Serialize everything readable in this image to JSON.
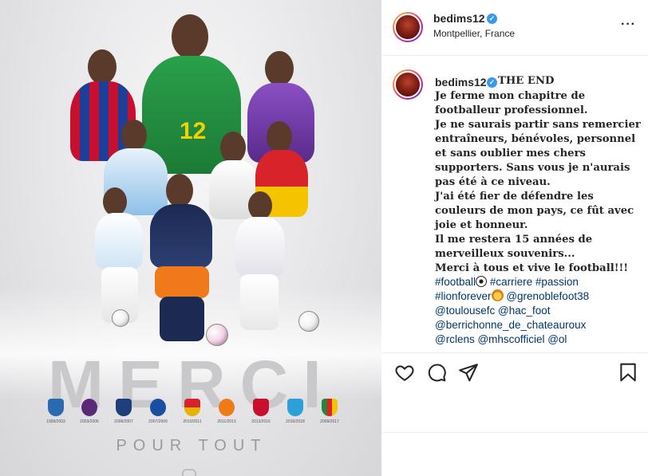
{
  "post": {
    "username": "bedims12",
    "location": "Montpellier, France",
    "caption_title": "THE END",
    "caption_lines": [
      "Je ferme mon chapitre de",
      "footballeur professionnel.",
      "Je ne saurais partir sans remercier",
      "entraîneurs, bénévoles, personnel",
      "et sans oublier mes chers",
      "supporters. Sans vous je n'aurais",
      "pas été à ce niveau.",
      "J'ai été fier de défendre les",
      "couleurs de mon pays, ce fût avec",
      "joie et honneur.",
      "Il me restera 15 années de",
      "merveilleux souvenirs...",
      "Merci à tous et vive le football!!!"
    ],
    "tags": {
      "line1_a": "#football",
      "line1_b": "#carriere #passion",
      "line2_a": "#lionforever",
      "line2_b": "@grenoblefoot38",
      "line3": "@toulousefc @hac_foot",
      "line4": "@berrichonne_de_chateauroux",
      "line5": "@rclens @mhscofficiel @ol"
    }
  },
  "poster": {
    "headline": "MERCI",
    "subline": "POUR TOUT",
    "shirt_number": "12",
    "clubs": [
      {
        "years": "1999/2003",
        "color": "#2a6ab0"
      },
      {
        "years": "2003/2006",
        "color": "#5a2a7a"
      },
      {
        "years": "2006/2007",
        "color": "#1d3f7a"
      },
      {
        "years": "2007/2009",
        "color": "#1b4ea0"
      },
      {
        "years": "2010/2011",
        "color": "#e6b400"
      },
      {
        "years": "2011/2013",
        "color": "#f07a1a"
      },
      {
        "years": "2013/2016",
        "color": "#c8102e"
      },
      {
        "years": "2016/2018",
        "color": "#2d9fd9"
      },
      {
        "years": "2009/2017",
        "color": "#1f8a3a"
      }
    ]
  },
  "icons": {
    "more": "more-options-icon",
    "like": "heart-icon",
    "comment": "comment-icon",
    "share": "share-icon",
    "save": "bookmark-icon",
    "verified": "verified-badge-icon"
  },
  "colors": {
    "link": "#00376b",
    "verified": "#3897f0",
    "text": "#262626"
  }
}
